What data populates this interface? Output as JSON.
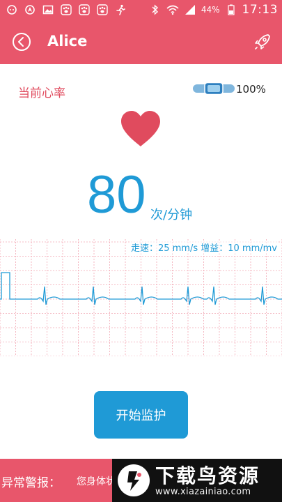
{
  "status_bar": {
    "battery": "44%",
    "time": "17:13",
    "left_icons": [
      "chat-icon",
      "nav-icon",
      "image-icon",
      "paw-icon",
      "paw-icon",
      "paw-icon",
      "runner-icon"
    ],
    "right_icons": [
      "bluetooth-icon",
      "wifi-icon",
      "signal-icon",
      "battery-icon"
    ]
  },
  "header": {
    "title": "Alice",
    "back_icon": "back-circle-icon",
    "share_icon": "rocket-icon"
  },
  "monitor": {
    "label": "当前心率",
    "battery_percent": "100%",
    "heart_rate": "80",
    "unit": "次/分钟",
    "ecg_settings": "走速：25 mm/s 增益：10 mm/mv",
    "colors": {
      "accent": "#e8566b",
      "heart": "#e04b5e",
      "blue": "#1f9ad6",
      "grid": "#f2a6b2"
    }
  },
  "actions": {
    "start_label": "开始监护"
  },
  "alert": {
    "label": "异常警报：",
    "text": "您身体状"
  },
  "watermark": {
    "title": "下载鸟资源",
    "url": "www.xiazainiao.com"
  }
}
